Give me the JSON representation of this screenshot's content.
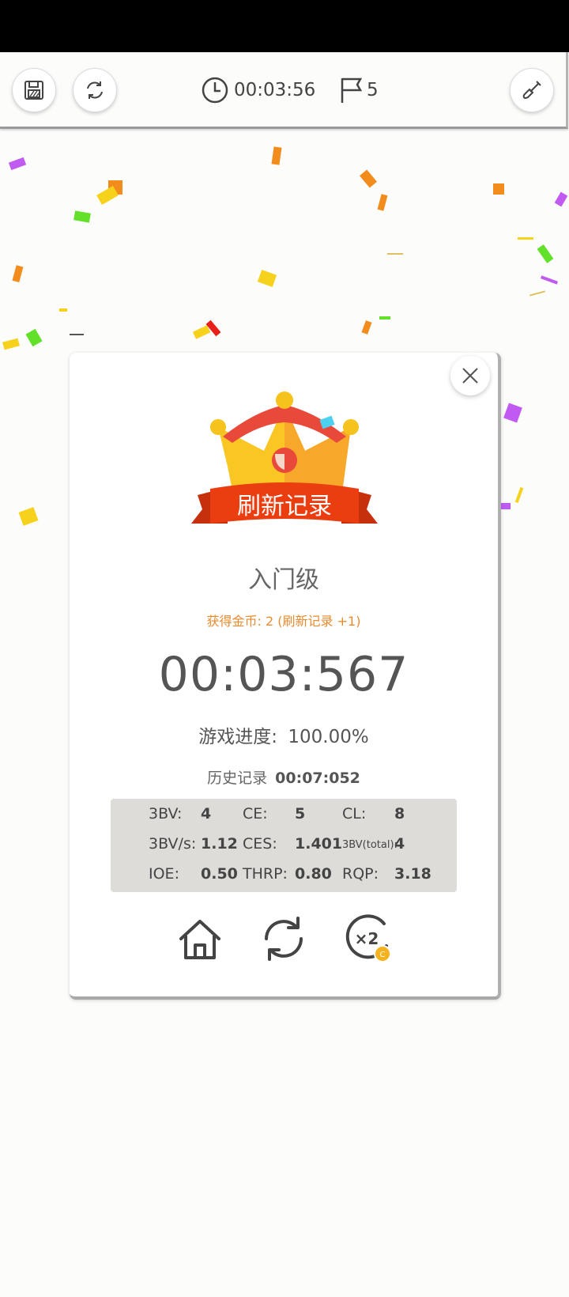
{
  "toolbar": {
    "save_icon": "save-icon",
    "restart_icon": "refresh-icon",
    "timer": "00:03:56",
    "flags": "5",
    "shovel_icon": "shovel-icon"
  },
  "result": {
    "banner": "刷新记录",
    "level": "入门级",
    "coins_text": "获得金币: 2 (刷新记录 +1)",
    "time": "00:03:567",
    "progress_label": "游戏进度:",
    "progress_value": "100.00%",
    "history_label": "历史记录",
    "history_value": "00:07:052"
  },
  "stats": [
    [
      {
        "label": "3BV:",
        "value": "4"
      },
      {
        "label": "CE:",
        "value": "5"
      },
      {
        "label": "CL:",
        "value": "8"
      }
    ],
    [
      {
        "label": "3BV/s:",
        "value": "1.12"
      },
      {
        "label": "CES:",
        "value": "1.401"
      },
      {
        "label": "3BV(total):",
        "value": "4"
      }
    ],
    [
      {
        "label": "IOE:",
        "value": "0.50"
      },
      {
        "label": "THRP:",
        "value": "0.80"
      },
      {
        "label": "RQP:",
        "value": "3.18"
      }
    ]
  ],
  "actions": {
    "home_icon": "home-icon",
    "replay_icon": "replay-icon",
    "double_icon": "double-coins-icon",
    "double_label": "×2",
    "coin_label": "C"
  },
  "colors": {
    "accent_orange": "#e88a2e",
    "crown_gold": "#f6c21c",
    "banner_red": "#ea3e10"
  }
}
